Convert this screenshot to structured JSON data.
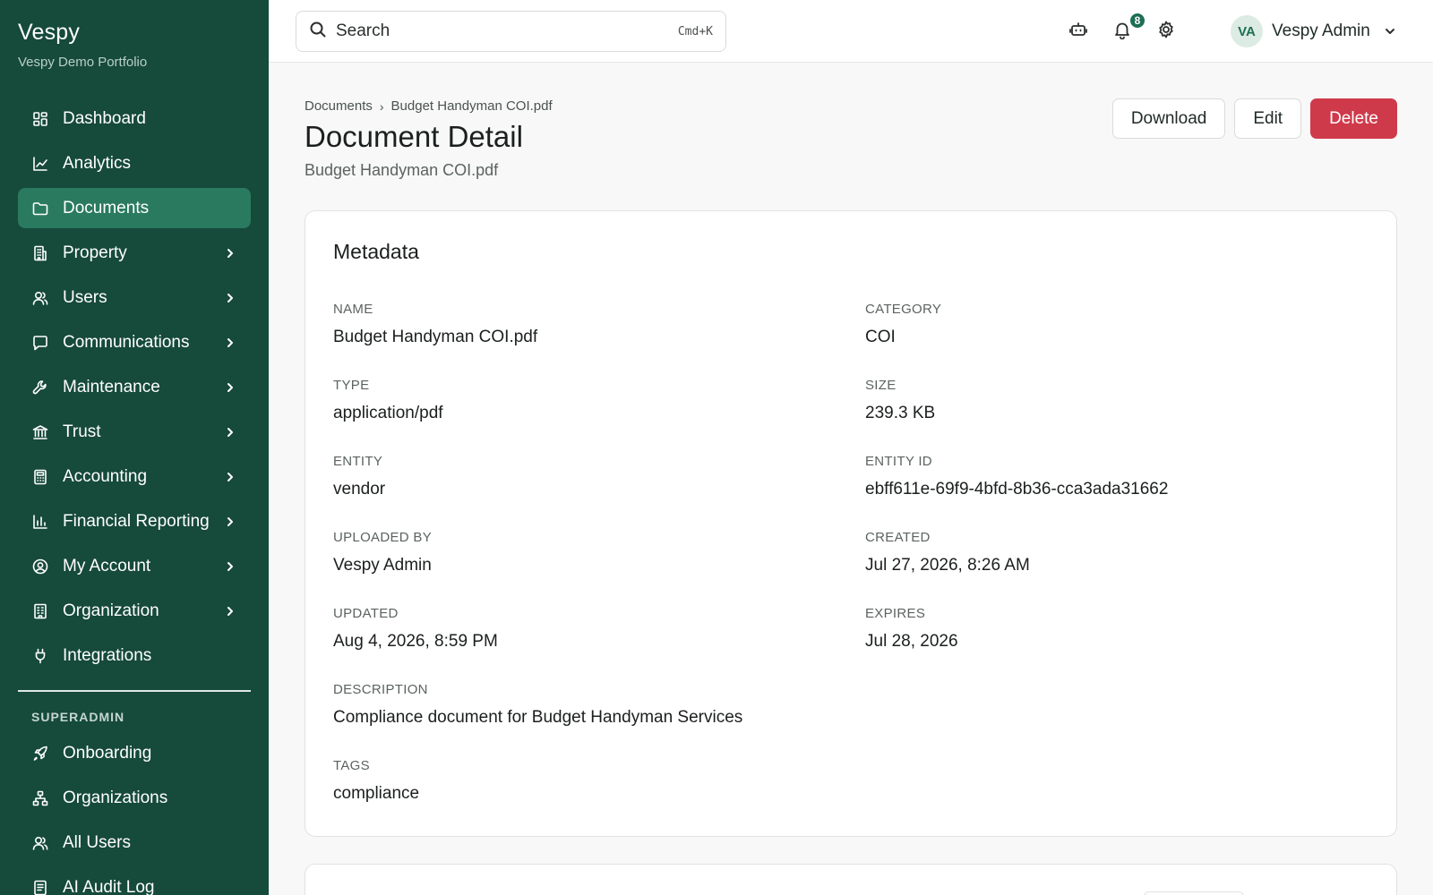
{
  "brand": {
    "title": "Vespy",
    "subtitle": "Vespy Demo Portfolio"
  },
  "sidebar": {
    "items": [
      {
        "label": "Dashboard",
        "icon": "grid-icon",
        "chevron": false,
        "active": false
      },
      {
        "label": "Analytics",
        "icon": "line-chart-icon",
        "chevron": false,
        "active": false
      },
      {
        "label": "Documents",
        "icon": "folder-icon",
        "chevron": false,
        "active": true
      },
      {
        "label": "Property",
        "icon": "building-icon",
        "chevron": true,
        "active": false
      },
      {
        "label": "Users",
        "icon": "users-icon",
        "chevron": true,
        "active": false
      },
      {
        "label": "Communications",
        "icon": "message-icon",
        "chevron": true,
        "active": false
      },
      {
        "label": "Maintenance",
        "icon": "wrench-icon",
        "chevron": true,
        "active": false
      },
      {
        "label": "Trust",
        "icon": "bank-icon",
        "chevron": true,
        "active": false
      },
      {
        "label": "Accounting",
        "icon": "calculator-icon",
        "chevron": true,
        "active": false
      },
      {
        "label": "Financial Reporting",
        "icon": "bar-chart-icon",
        "chevron": true,
        "active": false
      },
      {
        "label": "My Account",
        "icon": "user-circle-icon",
        "chevron": true,
        "active": false
      },
      {
        "label": "Organization",
        "icon": "office-icon",
        "chevron": true,
        "active": false
      },
      {
        "label": "Integrations",
        "icon": "plug-icon",
        "chevron": false,
        "active": false
      }
    ],
    "section_label": "SUPERADMIN",
    "admin_items": [
      {
        "label": "Onboarding",
        "icon": "rocket-icon"
      },
      {
        "label": "Organizations",
        "icon": "network-icon"
      },
      {
        "label": "All Users",
        "icon": "users-icon"
      },
      {
        "label": "AI Audit Log",
        "icon": "log-icon"
      }
    ]
  },
  "topbar": {
    "search_placeholder": "Search",
    "search_shortcut": "Cmd+K",
    "notification_count": "8",
    "user_initials": "VA",
    "user_name": "Vespy Admin"
  },
  "page": {
    "breadcrumb_root": "Documents",
    "breadcrumb_separator": "›",
    "breadcrumb_current": "Budget Handyman COI.pdf",
    "title": "Document Detail",
    "subtitle": "Budget Handyman COI.pdf",
    "actions": {
      "download": "Download",
      "edit": "Edit",
      "delete": "Delete"
    }
  },
  "metadata": {
    "title": "Metadata",
    "fields": {
      "name": {
        "label": "NAME",
        "value": "Budget Handyman COI.pdf"
      },
      "category": {
        "label": "CATEGORY",
        "value": "COI"
      },
      "type": {
        "label": "TYPE",
        "value": "application/pdf"
      },
      "size": {
        "label": "SIZE",
        "value": "239.3 KB"
      },
      "entity": {
        "label": "ENTITY",
        "value": "vendor"
      },
      "entity_id": {
        "label": "ENTITY ID",
        "value": "ebff611e-69f9-4bfd-8b36-cca3ada31662"
      },
      "uploaded_by": {
        "label": "UPLOADED BY",
        "value": "Vespy Admin"
      },
      "created": {
        "label": "CREATED",
        "value": "Jul 27, 2026, 8:26 AM"
      },
      "updated": {
        "label": "UPDATED",
        "value": "Aug 4, 2026, 8:59 PM"
      },
      "expires": {
        "label": "EXPIRES",
        "value": "Jul 28, 2026"
      },
      "description": {
        "label": "DESCRIPTION",
        "value": "Compliance document for Budget Handyman Services"
      },
      "tags": {
        "label": "TAGS",
        "value": "compliance"
      }
    }
  },
  "colors": {
    "sidebar_bg": "#164a3b",
    "active_item": "#2a7a5f",
    "danger": "#cf3a4b",
    "badge": "#1d6e55"
  }
}
